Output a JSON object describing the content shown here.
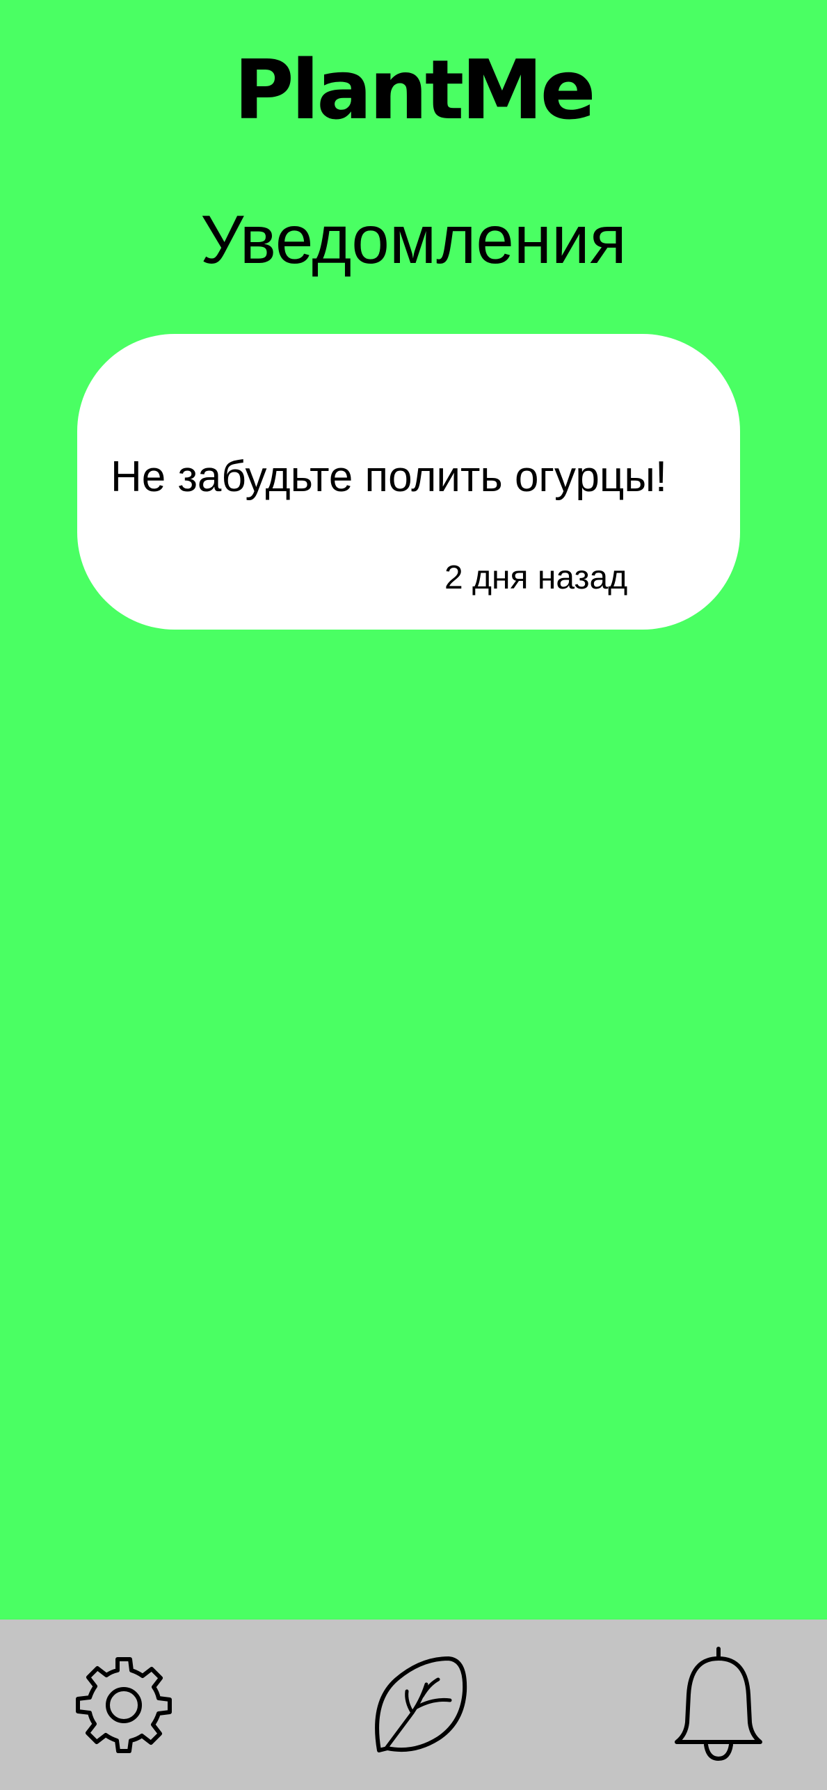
{
  "app": {
    "logo_text": "PlantMe"
  },
  "page": {
    "title": "Уведомления"
  },
  "notifications": [
    {
      "message": "Не забудьте полить огурцы!",
      "time": "2 дня назад"
    }
  ],
  "bottom_nav": {
    "items": [
      {
        "icon": "gear-icon",
        "name": "settings"
      },
      {
        "icon": "leaf-icon",
        "name": "plants"
      },
      {
        "icon": "bell-icon",
        "name": "notifications"
      }
    ]
  },
  "colors": {
    "background": "#4aff63",
    "card": "#ffffff",
    "nav_bar": "#c4c4c4",
    "text": "#000000"
  }
}
